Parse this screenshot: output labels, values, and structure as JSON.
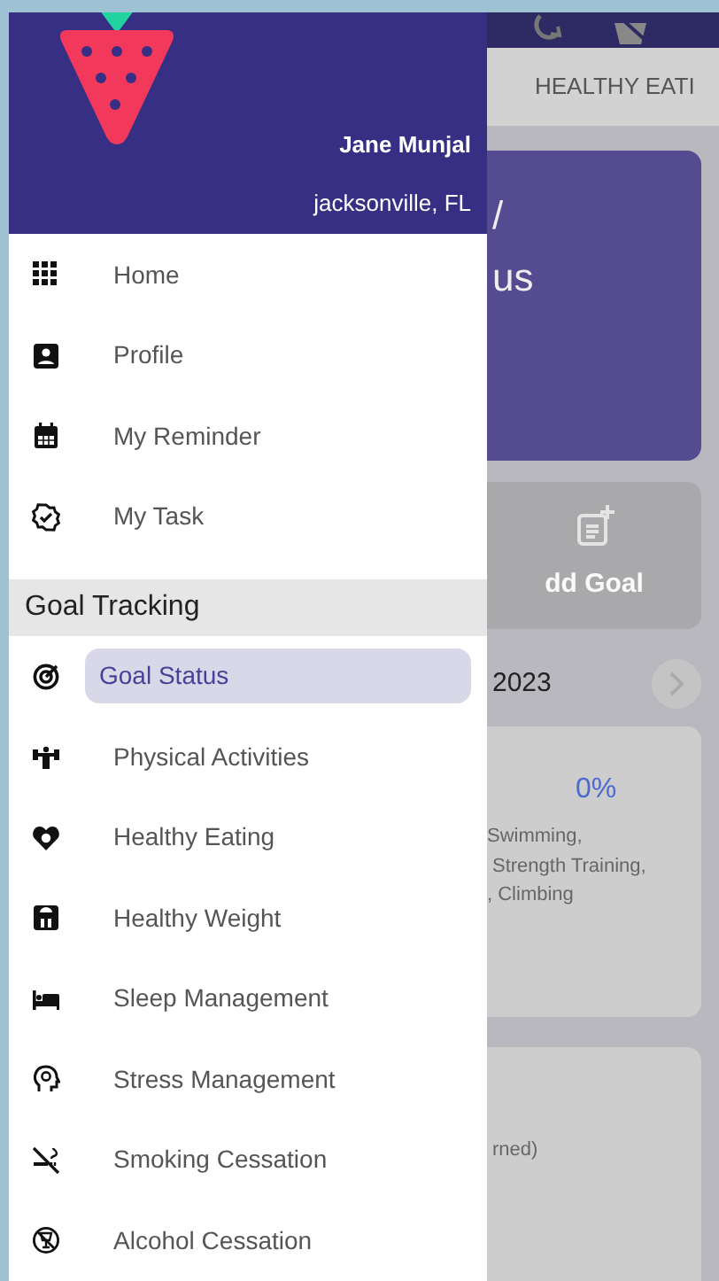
{
  "user": {
    "name": "Jane Munjal",
    "location": "jacksonville, FL"
  },
  "menu": [
    {
      "label": "Home"
    },
    {
      "label": "Profile"
    },
    {
      "label": "My Reminder"
    },
    {
      "label": "My Task"
    }
  ],
  "goal_tracking": {
    "title": "Goal Tracking",
    "items": [
      {
        "label": "Goal Status",
        "selected": true
      },
      {
        "label": "Physical Activities",
        "selected": false
      },
      {
        "label": "Healthy Eating",
        "selected": false
      },
      {
        "label": "Healthy Weight",
        "selected": false
      },
      {
        "label": "Sleep Management",
        "selected": false
      },
      {
        "label": "Stress Management",
        "selected": false
      },
      {
        "label": "Smoking Cessation",
        "selected": false
      },
      {
        "label": "Alcohol Cessation",
        "selected": false
      }
    ]
  },
  "background": {
    "tab": "HEALTHY EATI",
    "card_text": [
      "/",
      "us"
    ],
    "add_goal": "dd Goal",
    "date": "2023",
    "progress": "0%",
    "activities": [
      "Swimming,",
      "Strength Training,",
      ", Climbing"
    ],
    "note": "rned)"
  }
}
